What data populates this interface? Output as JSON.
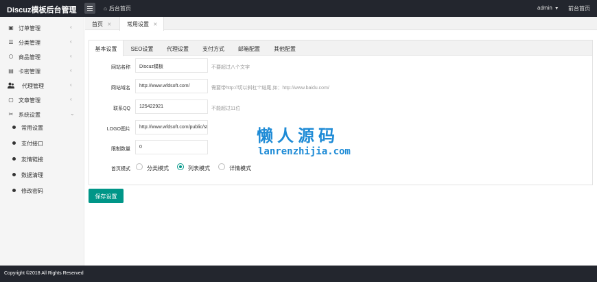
{
  "header": {
    "logo": "Discuz模板后台管理",
    "home_link": "后台首页",
    "user": "admin",
    "front_link": "前台首页"
  },
  "sidebar": {
    "items": [
      {
        "label": "订单管理",
        "icon": "briefcase-icon",
        "glyph": "▣"
      },
      {
        "label": "分类管理",
        "icon": "list-icon",
        "glyph": "☰"
      },
      {
        "label": "商品管理",
        "icon": "box-icon",
        "glyph": "⬡"
      },
      {
        "label": "卡密管理",
        "icon": "card-icon",
        "glyph": "▤"
      },
      {
        "label": "代理管理",
        "icon": "users-icon",
        "glyph": "👥"
      },
      {
        "label": "文章管理",
        "icon": "document-icon",
        "glyph": "▢"
      },
      {
        "label": "系统设置",
        "icon": "settings-icon",
        "glyph": "✂"
      }
    ],
    "sub_items": [
      {
        "label": "常用设置"
      },
      {
        "label": "支付接口"
      },
      {
        "label": "友情链接"
      },
      {
        "label": "数据清理"
      },
      {
        "label": "修改密码"
      }
    ]
  },
  "page_tabs": [
    {
      "label": "首页"
    },
    {
      "label": "常用设置"
    }
  ],
  "settings_tabs": [
    {
      "label": "基本设置"
    },
    {
      "label": "SEO设置"
    },
    {
      "label": "代理设置"
    },
    {
      "label": "支付方式"
    },
    {
      "label": "邮箱配置"
    },
    {
      "label": "其他配置"
    }
  ],
  "form": {
    "site_name": {
      "label": "网站名称",
      "value": "Discuz模板",
      "hint": "不要超过八个文字"
    },
    "site_domain": {
      "label": "网站域名",
      "value": "http://www.wfdsoft.com/",
      "hint": "需要带http://切以斜杠\"/\"结尾,如：http://www.baidu.com/"
    },
    "qq": {
      "label": "联系QQ",
      "value": "125422921",
      "hint": "不能超过11位"
    },
    "logo": {
      "label": "LOGO图片",
      "value": "http://www.wfdsoft.com/public/sta"
    },
    "limit": {
      "label": "限制数量",
      "value": "0"
    },
    "home_mode": {
      "label": "首页模式",
      "options": [
        "分类模式",
        "列表模式",
        "详情模式"
      ],
      "selected": "列表模式"
    }
  },
  "save_button": "保存设置",
  "watermark": {
    "cn": "懒人源码",
    "en": "lanrenzhijia.com"
  },
  "footer": "Copyright ©2018 All Rights Reserved",
  "colors": {
    "accent": "#009688",
    "header_bg": "#23262e",
    "watermark": "#1e8bd6"
  }
}
